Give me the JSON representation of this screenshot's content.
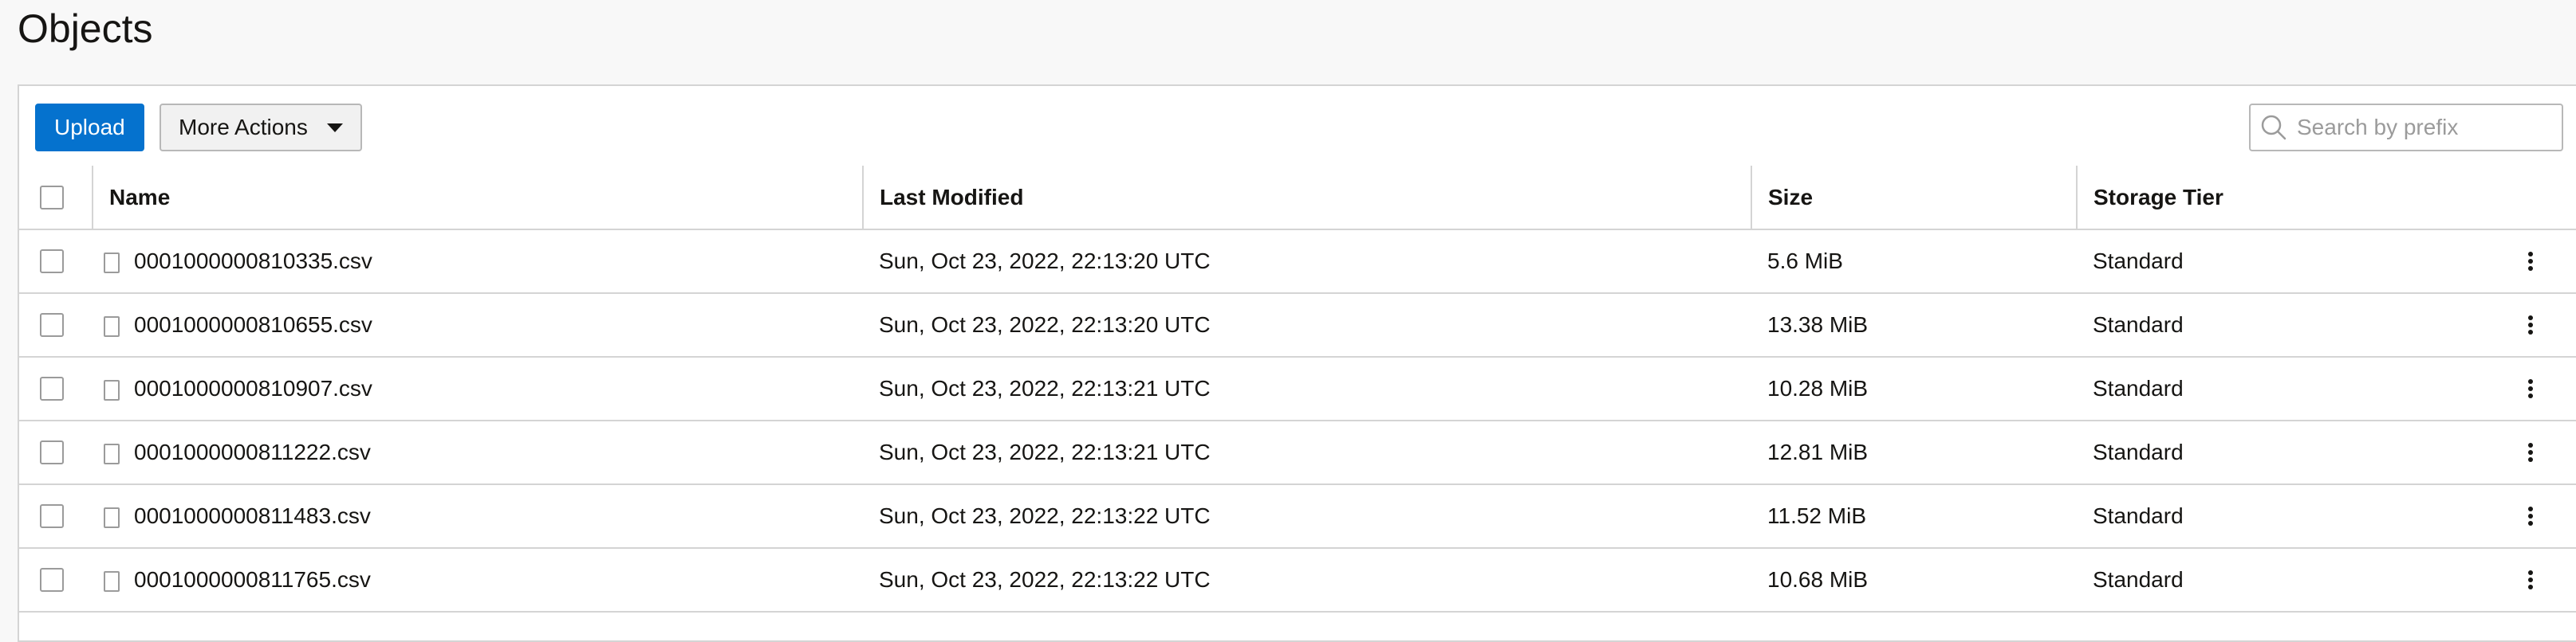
{
  "page": {
    "title": "Objects"
  },
  "toolbar": {
    "upload_label": "Upload",
    "more_actions_label": "More Actions",
    "search_placeholder": "Search by prefix"
  },
  "table": {
    "columns": [
      "Name",
      "Last Modified",
      "Size",
      "Storage Tier"
    ],
    "rows": [
      {
        "name": "0001000000810335.csv",
        "modified": "Sun, Oct 23, 2022, 22:13:20 UTC",
        "size": "5.6 MiB",
        "tier": "Standard"
      },
      {
        "name": "0001000000810655.csv",
        "modified": "Sun, Oct 23, 2022, 22:13:20 UTC",
        "size": "13.38 MiB",
        "tier": "Standard"
      },
      {
        "name": "0001000000810907.csv",
        "modified": "Sun, Oct 23, 2022, 22:13:21 UTC",
        "size": "10.28 MiB",
        "tier": "Standard"
      },
      {
        "name": "0001000000811222.csv",
        "modified": "Sun, Oct 23, 2022, 22:13:21 UTC",
        "size": "12.81 MiB",
        "tier": "Standard"
      },
      {
        "name": "0001000000811483.csv",
        "modified": "Sun, Oct 23, 2022, 22:13:22 UTC",
        "size": "11.52 MiB",
        "tier": "Standard"
      },
      {
        "name": "0001000000811765.csv",
        "modified": "Sun, Oct 23, 2022, 22:13:22 UTC",
        "size": "10.68 MiB",
        "tier": "Standard"
      }
    ]
  },
  "colors": {
    "primary": "#0572ce",
    "border": "#d4d4d4",
    "text": "#161513"
  },
  "icons": {
    "search": "search-icon",
    "file": "file-icon",
    "row_menu": "kebab-menu-icon",
    "dropdown": "caret-down-icon"
  }
}
